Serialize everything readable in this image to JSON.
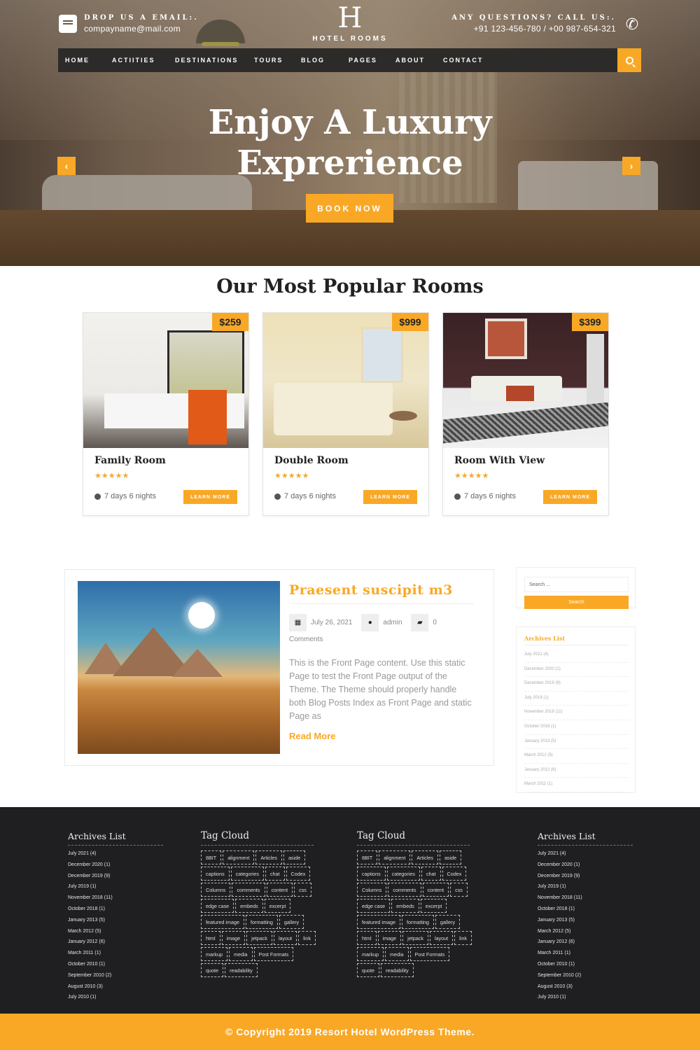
{
  "header": {
    "email_label": "DROP US A EMAIL:.",
    "email_value": "compayname@mail.com",
    "phone_label": "ANY QUESTIONS? CALL US:.",
    "phone_value": "+91 123-456-780 / +00 987-654-321",
    "logo_letter": "H",
    "logo_text": "HOTEL ROOMS"
  },
  "nav": {
    "items": [
      "HOME",
      "ACTIITIES",
      "DESTINATIONS",
      "TOURS",
      "BLOG",
      "PAGES",
      "ABOUT",
      "CONTACT"
    ]
  },
  "hero": {
    "title_line1": "Enjoy A Luxury",
    "title_line2": "Exprerience",
    "cta": "BOOK NOW",
    "prev": "‹",
    "next": "›"
  },
  "rooms": {
    "title": "Our Most Popular Rooms",
    "items": [
      {
        "name": "Family Room",
        "price": "$259",
        "rating": 5,
        "duration": "7 days 6 nights",
        "cta": "LEARN MORE"
      },
      {
        "name": "Double Room",
        "price": "$999",
        "rating": 5,
        "duration": "7 days 6 nights",
        "cta": "LEARN MORE"
      },
      {
        "name": "Room With View",
        "price": "$399",
        "rating": 5,
        "duration": "7 days 6 nights",
        "cta": "LEARN MORE"
      }
    ]
  },
  "post": {
    "title": "Praesent suscipit m3",
    "date": "July 26, 2021",
    "author": "admin",
    "comments": "0 Comments",
    "excerpt": "This is the Front Page content. Use this static Page to test the Front Page output of the Theme. The Theme should properly handle both Blog Posts Index as Front Page and static Page as",
    "read_more": "Read More"
  },
  "sidebar": {
    "search_placeholder": "Search ...",
    "search_button": "Search",
    "archives_title": "Archives List",
    "archives": [
      "July 2021 (4)",
      "December 2020 (1)",
      "December 2019 (9)",
      "July 2019 (1)",
      "November 2018 (11)",
      "October 2018 (1)",
      "January 2013 (5)",
      "March 2012 (5)",
      "January 2012 (6)",
      "March 2011 (1)"
    ]
  },
  "footer": {
    "archives_title": "Archives List",
    "archives": [
      "July 2021 (4)",
      "December 2020 (1)",
      "December 2019 (9)",
      "July 2019 (1)",
      "November 2018 (11)",
      "October 2018 (1)",
      "January 2013 (5)",
      "March 2012 (5)",
      "January 2012 (6)",
      "March 2011 (1)",
      "October 2010 (1)",
      "September 2010 (2)",
      "August 2010 (3)",
      "July 2010 (1)"
    ],
    "tags_title": "Tag Cloud",
    "tags": [
      "8BIT",
      "alignment",
      "Articles",
      "aside",
      "captions",
      "categories",
      "chat",
      "Codex",
      "Columns",
      "comments",
      "content",
      "css",
      "edge case",
      "embeds",
      "excerpt",
      "featured image",
      "formatting",
      "gallery",
      "html",
      "image",
      "jetpack",
      "layout",
      "link",
      "markup",
      "media",
      "Post Formats",
      "quote",
      "readability"
    ],
    "copyright": "© Copyright 2019 Resort Hotel WordPress Theme."
  },
  "colors": {
    "accent": "#f9a825",
    "footer_bg": "#1f1e20",
    "nav_bg": "#2d2b29"
  }
}
